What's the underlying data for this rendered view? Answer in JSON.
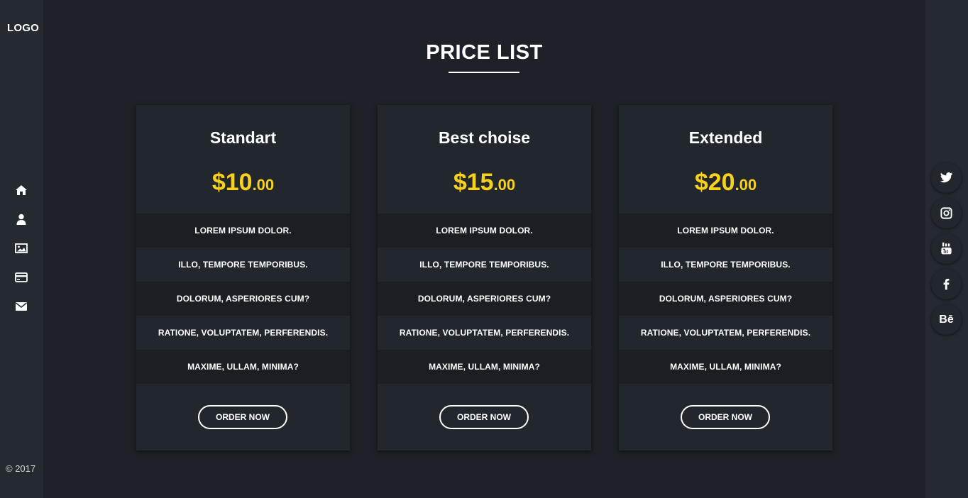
{
  "sidebar": {
    "logo": "LOGO",
    "nav": [
      {
        "icon": "home-icon"
      },
      {
        "icon": "user-icon"
      },
      {
        "icon": "image-icon"
      },
      {
        "icon": "credit-card-icon"
      },
      {
        "icon": "envelope-icon"
      }
    ],
    "copyright": "© 2017"
  },
  "main": {
    "title": "PRICE LIST",
    "cards": [
      {
        "name": "Standart",
        "price_main": "$10",
        "price_cents": ".00",
        "features": [
          "LOREM IPSUM DOLOR.",
          "ILLO, TEMPORE TEMPORIBUS.",
          "DOLORUM, ASPERIORES CUM?",
          "RATIONE, VOLUPTATEM, PERFERENDIS.",
          "MAXIME, ULLAM, MINIMA?"
        ],
        "button": "ORDER NOW"
      },
      {
        "name": "Best choise",
        "price_main": "$15",
        "price_cents": ".00",
        "features": [
          "LOREM IPSUM DOLOR.",
          "ILLO, TEMPORE TEMPORIBUS.",
          "DOLORUM, ASPERIORES CUM?",
          "RATIONE, VOLUPTATEM, PERFERENDIS.",
          "MAXIME, ULLAM, MINIMA?"
        ],
        "button": "ORDER NOW"
      },
      {
        "name": "Extended",
        "price_main": "$20",
        "price_cents": ".00",
        "features": [
          "LOREM IPSUM DOLOR.",
          "ILLO, TEMPORE TEMPORIBUS.",
          "DOLORUM, ASPERIORES CUM?",
          "RATIONE, VOLUPTATEM, PERFERENDIS.",
          "MAXIME, ULLAM, MINIMA?"
        ],
        "button": "ORDER NOW"
      }
    ]
  },
  "social": {
    "items": [
      {
        "icon": "twitter-icon"
      },
      {
        "icon": "instagram-icon"
      },
      {
        "icon": "youtube-icon"
      },
      {
        "icon": "facebook-icon"
      },
      {
        "icon": "behance-icon",
        "text": "Bē"
      }
    ]
  },
  "colors": {
    "accent": "#f7d11d",
    "background": "#1e2127",
    "sidebar": "#252a31",
    "card": "#22272e"
  }
}
